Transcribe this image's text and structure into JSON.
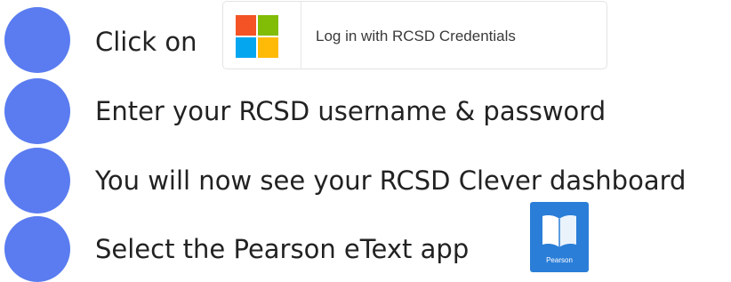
{
  "colors": {
    "step_dot": "#5a7cf0",
    "tile_blue": "#2a7ed8"
  },
  "steps": [
    {
      "text": "Click on"
    },
    {
      "text": "Enter your RCSD username & password"
    },
    {
      "text": "You will now see your RCSD Clever dashboard"
    },
    {
      "text": "Select the Pearson eText app"
    }
  ],
  "login_button": {
    "icon": "microsoft-logo-icon",
    "label": "Log in with RCSD Credentials"
  },
  "app_tile": {
    "icon": "open-book-icon",
    "name": "Pearson"
  }
}
